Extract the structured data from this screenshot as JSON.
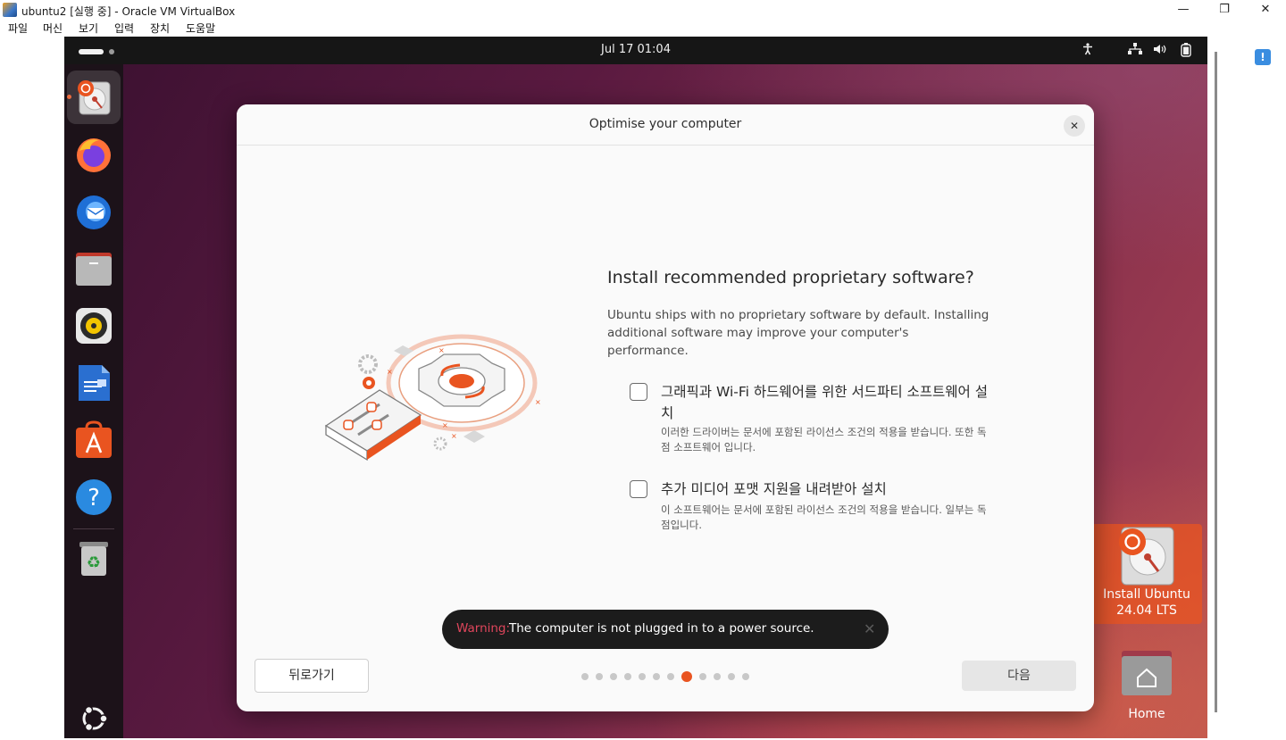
{
  "host": {
    "window_title": "ubuntu2 [실행 중] - Oracle VM VirtualBox",
    "controls": {
      "minimize": "—",
      "maximize": "❐",
      "close": "✕"
    },
    "menu": [
      "파일",
      "머신",
      "보기",
      "입력",
      "장치",
      "도움말"
    ]
  },
  "topbar": {
    "clock": "Jul 17  01:04",
    "tray_icons": [
      "accessibility-icon",
      "network-icon",
      "volume-icon",
      "battery-icon"
    ]
  },
  "dock": {
    "items": [
      {
        "name": "install-ubuntu",
        "running": true,
        "active": true
      },
      {
        "name": "firefox"
      },
      {
        "name": "thunderbird"
      },
      {
        "name": "files"
      },
      {
        "name": "rhythmbox"
      },
      {
        "name": "libreoffice-writer"
      },
      {
        "name": "app-center"
      },
      {
        "name": "help"
      },
      {
        "name": "trash"
      }
    ],
    "show_apps_icon": "ubuntu-logo-icon"
  },
  "desktop": {
    "install_icon": {
      "label1": "Install Ubuntu",
      "label2": "24.04 LTS"
    },
    "home_icon": {
      "label": "Home"
    }
  },
  "dialog": {
    "title": "Optimise your computer",
    "heading": "Install recommended proprietary software?",
    "description": "Ubuntu ships with no proprietary software by default. Installing additional software may improve your computer's performance.",
    "options": [
      {
        "title": "그래픽과 Wi-Fi 하드웨어를 위한 서드파티 소프트웨어 설치",
        "description": "이러한 드라이버는 문서에 포함된 라이선스 조건의 적용을 받습니다. 또한 독점 소프트웨어 입니다.",
        "checked": false
      },
      {
        "title": "추가 미디어 포맷 지원을 내려받아 설치",
        "description": "이 소프트웨어는 문서에 포함된 라이선스 조건의 적용을 받습니다. 일부는 독점입니다.",
        "checked": false
      }
    ],
    "back_label": "뒤로가기",
    "next_label": "다음",
    "progress": {
      "total": 12,
      "current": 8
    }
  },
  "toast": {
    "warning_label": "Warning:",
    "message": "The computer is not plugged in to a power source.",
    "close": "✕"
  },
  "colors": {
    "accent": "#e95420",
    "warning": "#e0465c",
    "topbar": "#161616",
    "dock": "#1c1219"
  }
}
